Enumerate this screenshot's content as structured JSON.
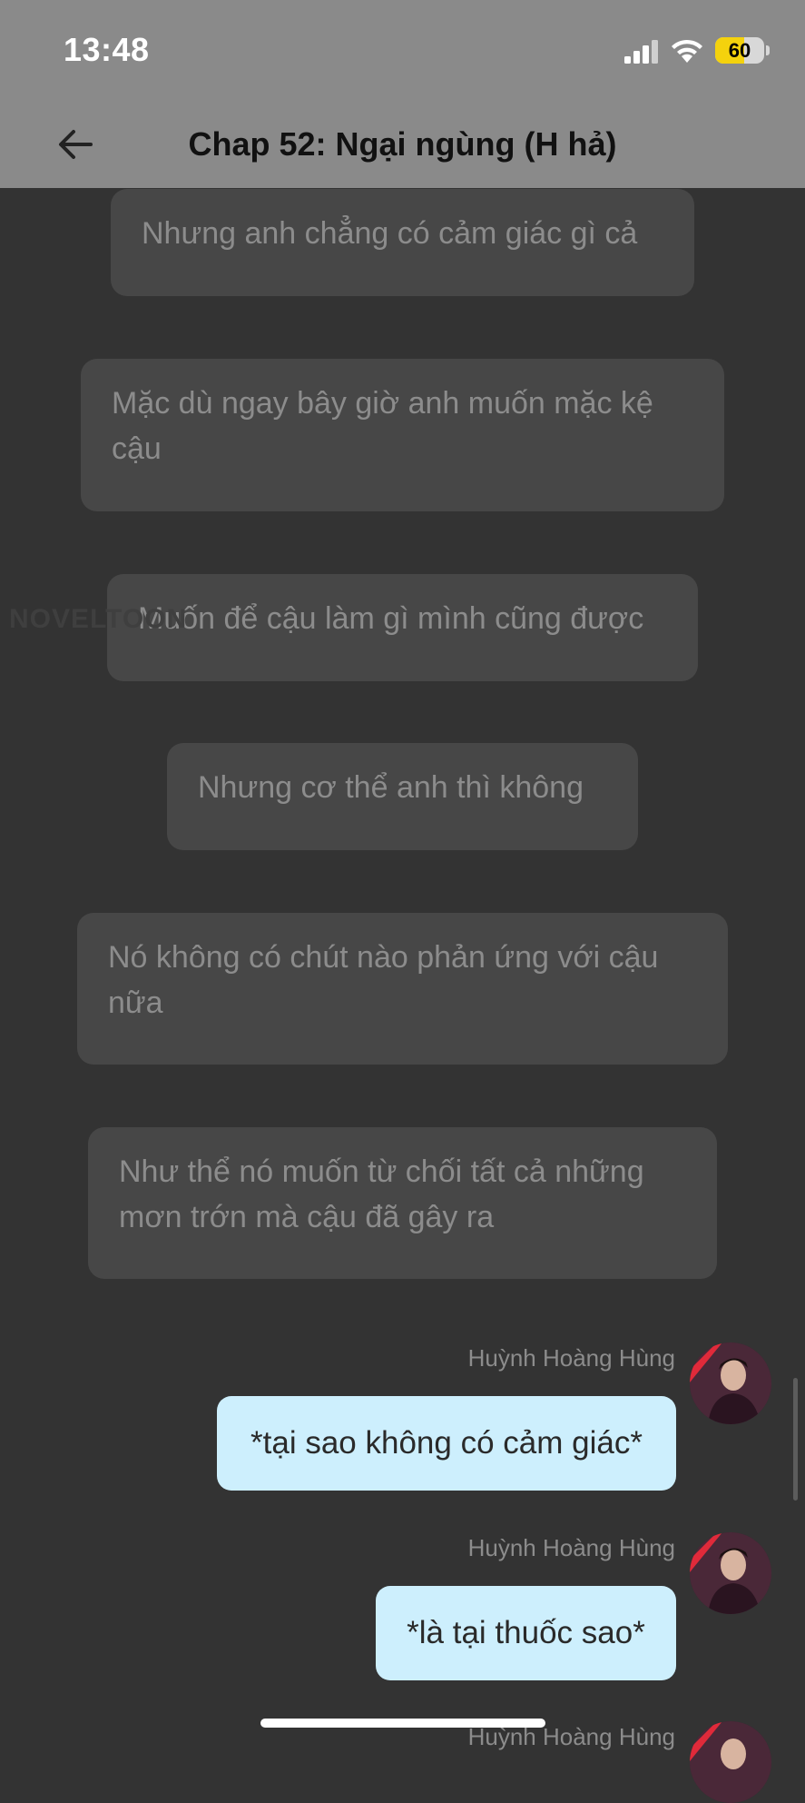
{
  "status": {
    "time": "13:48",
    "battery": "60",
    "battery_level": 0.6
  },
  "header": {
    "title": "Chap 52: Ngại ngùng (H hả)"
  },
  "watermark": "NOVELTOON",
  "narration": [
    "Nhưng anh chẳng có cảm giác gì cả",
    "Mặc dù ngay bây giờ anh muốn mặc kệ cậu",
    "Muốn để cậu làm gì mình cũng được",
    "Nhưng cơ thể anh thì không",
    "Nó không có chút nào phản ứng với cậu nữa",
    "Như thể nó muốn từ chối tất cả những mơn trớn mà cậu đã gây ra"
  ],
  "messages": [
    {
      "sender": "Huỳnh Hoàng Hùng",
      "text": "*tại sao không có cảm giác*"
    },
    {
      "sender": "Huỳnh Hoàng Hùng",
      "text": "*là tại thuốc sao*"
    },
    {
      "sender": "Huỳnh Hoàng Hùng"
    }
  ],
  "colors": {
    "background": "#333333",
    "bubble_narration": "#474747",
    "bubble_message": "#cdeffd",
    "header": "#8a8a8a",
    "battery": "#f4d20d"
  },
  "icons": [
    "back-arrow-icon",
    "cellular-signal-icon",
    "wifi-icon",
    "battery-icon"
  ]
}
